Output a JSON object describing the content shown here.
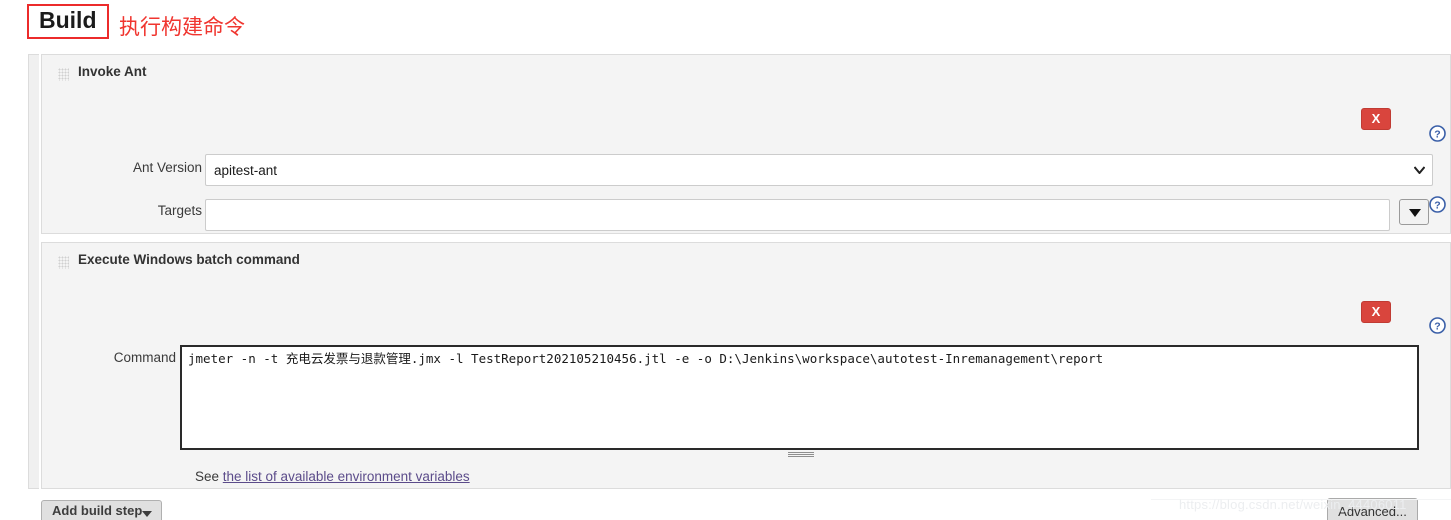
{
  "header": {
    "section_label": "Build",
    "annotation": "执行构建命令"
  },
  "build_steps": [
    {
      "title": "Invoke Ant",
      "delete_label": "X",
      "help_icon": "help-circle-icon",
      "drag_icon": "drag-handle-icon",
      "fields": [
        {
          "label": "Ant Version",
          "type": "select",
          "value": "apitest-ant",
          "options": [
            "apitest-ant"
          ]
        },
        {
          "label": "Targets",
          "type": "text",
          "value": "",
          "placeholder": "",
          "combo_icon": "triangle-down-icon"
        }
      ],
      "advanced_label": "Advanced..."
    },
    {
      "title": "Execute Windows batch command",
      "delete_label": "X",
      "help_icon": "help-circle-icon",
      "drag_icon": "drag-handle-icon",
      "fields": [
        {
          "label": "Command",
          "type": "textarea",
          "value": "jmeter -n -t 充电云发票与退款管理.jmx -l TestReport202105210456.jtl -e -o D:\\Jenkins\\workspace\\autotest-Inremanagement\\report",
          "placeholder": ""
        }
      ],
      "env_prefix": "See ",
      "env_link": "the list of available environment variables",
      "advanced_label": "Advanced..."
    }
  ],
  "footer": {
    "add_build_step_label": "Add build step",
    "caret_icon": "caret-down-icon"
  },
  "watermark": {
    "text": "https://blog.csdn.net/weixin_44406011"
  },
  "colors": {
    "accent_red": "#f0352f",
    "delete_red": "#d9453d",
    "help_blue": "#3a5fa8",
    "link_purple": "#5b4b8a",
    "panel_bg": "#f4f4f4",
    "panel_border": "#dcdcdc"
  }
}
